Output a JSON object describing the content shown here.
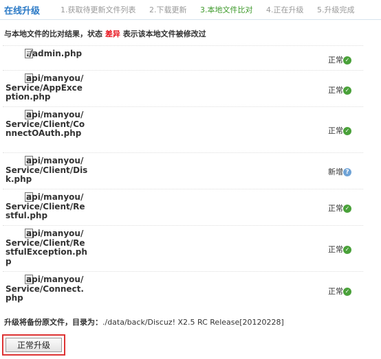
{
  "header": {
    "title": "在线升级",
    "steps": [
      "1.获取待更新文件列表",
      "2.下载更新",
      "3.本地文件比对",
      "4.正在升级",
      "5.升级完成"
    ]
  },
  "summary": {
    "prefix": "与本地文件的比对结果，状态",
    "diff": "差异",
    "suffix": "表示该本地文件被修改过"
  },
  "files": [
    {
      "path": "./admin.php",
      "status": "正常"
    },
    {
      "path": "api/manyou/Service/AppException.php",
      "status": "正常"
    },
    {
      "path": "api/manyou/Service/Client/ConnectOAuth.php",
      "status": "正常"
    },
    {
      "path": "api/manyou/Service/Client/Disk.php",
      "status": "新增"
    },
    {
      "path": "api/manyou/Service/Client/Restful.php",
      "status": "正常"
    },
    {
      "path": "api/manyou/Service/Client/RestfulException.php",
      "status": "正常"
    },
    {
      "path": "api/manyou/Service/Connect.php",
      "status": "正常"
    }
  ],
  "backup": {
    "label": "升级将备份原文件，目录为：",
    "path": "./data/back/Discuz! X2.5 RC Release[20120228]"
  },
  "button": {
    "label": "正常升级"
  },
  "icons": {
    "file": "file-icon",
    "ok": "check-circle-icon",
    "new": "question-circle-icon"
  },
  "colors": {
    "title": "#2b7ac6",
    "active_step": "#3e9a2b",
    "diff": "#e8141e",
    "ok": "#4aa13a"
  }
}
